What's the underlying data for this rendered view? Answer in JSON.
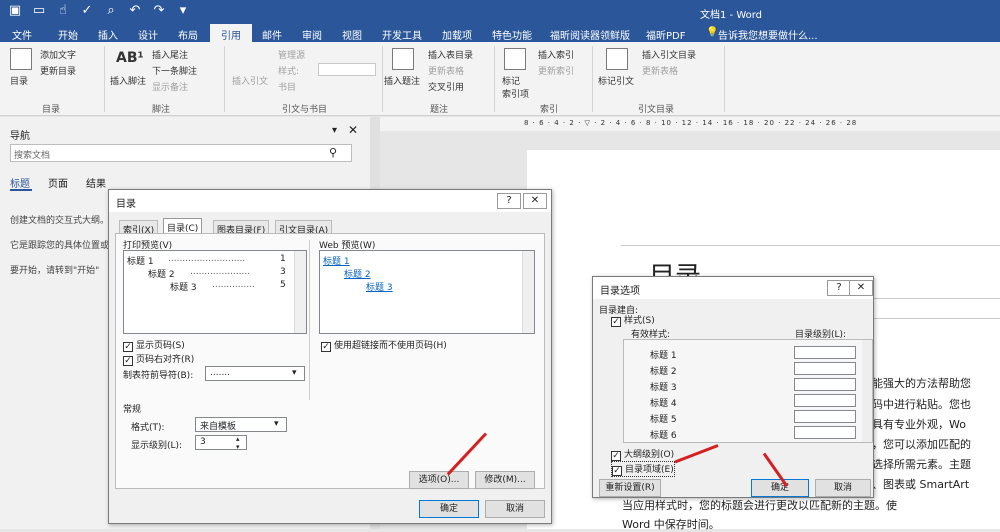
{
  "app": {
    "title": "文档1 - Word"
  },
  "tabs": {
    "file": "文件",
    "home": "开始",
    "insert": "插入",
    "design": "设计",
    "layout": "布局",
    "references": "引用",
    "mailings": "邮件",
    "review": "审阅",
    "view": "视图",
    "developer": "开发工具",
    "addins": "加载项",
    "special": "特色功能",
    "foxit_reader": "福昕阅读器领鲜版",
    "foxit_pdf": "福昕PDF",
    "tellme": "告诉我您想要做什么..."
  },
  "ribbon": {
    "toc": "目录",
    "add_text": "添加文字",
    "update_toc": "更新目录",
    "group_toc": "目录",
    "insert_footnote": "插入脚注",
    "insert_endnote": "插入尾注",
    "next_footnote": "下一条脚注",
    "show_notes": "显示备注",
    "group_footnotes": "脚注",
    "insert_citation": "插入引文",
    "manage_sources": "管理源",
    "style": "样式:",
    "bibliography": "书目",
    "group_citations": "引文与书目",
    "insert_caption": "插入题注",
    "insert_tof": "插入表目录",
    "update_table": "更新表格",
    "cross_ref": "交叉引用",
    "group_captions": "题注",
    "mark_entry": "标记\n索引项",
    "insert_index": "插入索引",
    "update_index": "更新索引",
    "group_index": "索引",
    "mark_citation": "标记引文",
    "insert_toa": "插入引文目录",
    "update_toa": "更新表格",
    "group_toa": "引文目录"
  },
  "nav": {
    "title": "导航",
    "search_placeholder": "搜索文档",
    "tab_headings": "标题",
    "tab_pages": "页面",
    "tab_results": "结果",
    "line1": "创建文档的交互式大纲。",
    "line2": "它是跟踪您的具体位置或",
    "line3": "要开始，请转到\"开始\""
  },
  "toc_dialog": {
    "title": "目录",
    "tabs": [
      "索引(X)",
      "目录(C)",
      "图表目录(F)",
      "引文目录(A)"
    ],
    "print_preview_label": "打印预览(V)",
    "print_preview": [
      "标题 1",
      "标题 2",
      "标题 3"
    ],
    "page_nums": [
      "1",
      "3",
      "5"
    ],
    "web_preview_label": "Web 预览(W)",
    "web_preview": [
      "标题 1",
      "标题 2",
      "标题 3"
    ],
    "show_page_numbers": "显示页码(S)",
    "right_align": "页码右对齐(R)",
    "tab_leader_label": "制表符前导符(B):",
    "tab_leader_value": ".......",
    "use_hyperlinks": "使用超链接而不使用页码(H)",
    "general": "常规",
    "formats_label": "格式(T):",
    "formats_value": "来自模板",
    "levels_label": "显示级别(L):",
    "levels_value": "3",
    "options": "选项(O)...",
    "modify": "修改(M)...",
    "ok": "确定",
    "cancel": "取消"
  },
  "opt_dialog": {
    "title": "目录选项",
    "build_from": "目录建自:",
    "styles": "样式(S)",
    "available": "有效样式:",
    "toc_level": "目录级别(L):",
    "items": [
      "标题 1",
      "标题 2",
      "标题 3",
      "标题 4",
      "标题 5",
      "标题 6"
    ],
    "outline": "大纲级别(O)",
    "fields": "目录项域(E)",
    "reset": "重新设置(R)",
    "ok": "确定",
    "cancel": "取消"
  },
  "doc": {
    "heading": "目录",
    "lines": [
      "能强大的方法帮助您",
      "码中进行粘贴。您也",
      "具有专业外观，Wo",
      "，您可以添加匹配的",
      "选择所需元素。主题",
      "、图表或 SmartArt",
      "当应用样式时，您的标题会进行更改以匹配新的主题。使",
      "Word 中保存时间。"
    ]
  },
  "colors": {
    "accent": "#2b579a",
    "arrow": "#d42020"
  }
}
